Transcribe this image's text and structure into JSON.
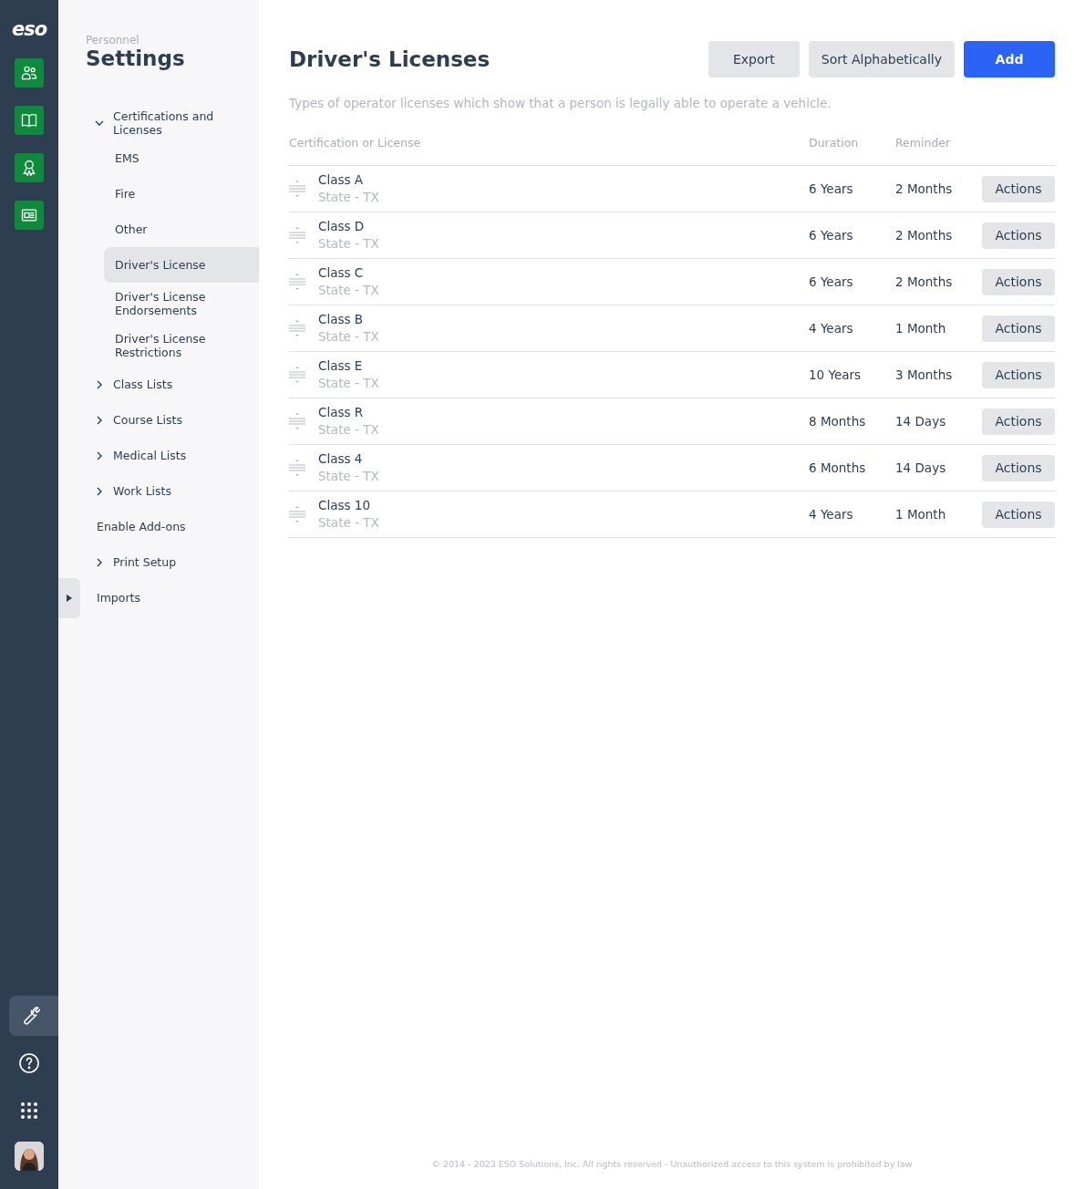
{
  "rail": {
    "logo": "eso",
    "apps": [
      {
        "kind": "people"
      },
      {
        "kind": "book"
      },
      {
        "kind": "award"
      },
      {
        "kind": "news"
      }
    ],
    "tools": [
      {
        "kind": "wrench",
        "selected": true
      },
      {
        "kind": "help",
        "selected": false
      },
      {
        "kind": "grid",
        "selected": false
      }
    ]
  },
  "sidebar": {
    "eyebrow": "Personnel",
    "title": "Settings",
    "items": [
      {
        "label": "Certifications and Licenses",
        "kind": "group",
        "expanded": true,
        "selected": false,
        "children": [
          {
            "label": "EMS",
            "selected": false
          },
          {
            "label": "Fire",
            "selected": false
          },
          {
            "label": "Other",
            "selected": false
          },
          {
            "label": "Driver's License",
            "selected": true
          },
          {
            "label": "Driver's License Endorsements",
            "selected": false
          },
          {
            "label": "Driver's License Restrictions",
            "selected": false
          }
        ]
      },
      {
        "label": "Class Lists",
        "kind": "group",
        "expanded": false,
        "selected": false
      },
      {
        "label": "Course Lists",
        "kind": "group",
        "expanded": false,
        "selected": false
      },
      {
        "label": "Medical Lists",
        "kind": "group",
        "expanded": false,
        "selected": false
      },
      {
        "label": "Work Lists",
        "kind": "group",
        "expanded": false,
        "selected": false
      },
      {
        "label": "Enable Add-ons",
        "kind": "link",
        "selected": false
      },
      {
        "label": "Print Setup",
        "kind": "group",
        "expanded": false,
        "selected": false
      },
      {
        "label": "Imports",
        "kind": "link",
        "selected": false
      }
    ]
  },
  "main": {
    "title": "Driver's Licenses",
    "buttons": [
      {
        "label": "Export",
        "kind": "secondary"
      },
      {
        "label": "Sort Alphabetically",
        "kind": "secondary"
      },
      {
        "label": "Add",
        "kind": "primary"
      }
    ],
    "description": "Types of operator licenses which show that a person is legally able to operate a vehicle.",
    "table": {
      "columns": [
        "Certification or License",
        "Duration",
        "Reminder"
      ],
      "rows": [
        {
          "name": "Class A",
          "sub": "State - TX",
          "duration": "6 Years",
          "reminder": "2 Months",
          "action": "Actions"
        },
        {
          "name": "Class D",
          "sub": "State - TX",
          "duration": "6 Years",
          "reminder": "2 Months",
          "action": "Actions"
        },
        {
          "name": "Class C",
          "sub": "State - TX",
          "duration": "6 Years",
          "reminder": "2 Months",
          "action": "Actions"
        },
        {
          "name": "Class B",
          "sub": "State - TX",
          "duration": "4 Years",
          "reminder": "1 Month",
          "action": "Actions"
        },
        {
          "name": "Class E",
          "sub": "State - TX",
          "duration": "10 Years",
          "reminder": "3 Months",
          "action": "Actions"
        },
        {
          "name": "Class R",
          "sub": "State - TX",
          "duration": "8 Months",
          "reminder": "14 Days",
          "action": "Actions"
        },
        {
          "name": "Class 4",
          "sub": "State - TX",
          "duration": "6 Months",
          "reminder": "14 Days",
          "action": "Actions"
        },
        {
          "name": "Class 10",
          "sub": "State - TX",
          "duration": "4 Years",
          "reminder": "1 Month",
          "action": "Actions"
        }
      ]
    },
    "footer": "© 2014 - 2023 ESO Solutions, Inc. All rights reserved - Unauthorized access to this system is prohibited by law"
  }
}
